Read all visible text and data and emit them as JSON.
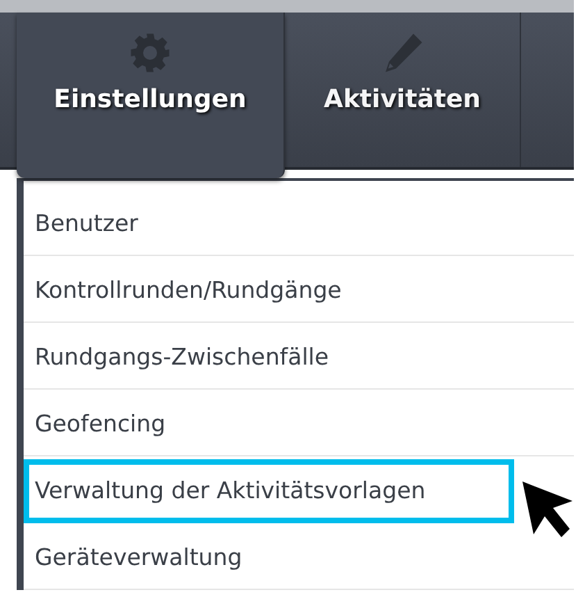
{
  "nav_tabs": [
    {
      "label": "Einstellungen",
      "kind": "gear",
      "selected": true
    },
    {
      "label": "Aktivitäten",
      "kind": "pencil",
      "selected": false
    }
  ],
  "menu_items": [
    {
      "label": "Benutzer",
      "selected": false
    },
    {
      "label": "Kontrollrunden/Rundgänge",
      "selected": false
    },
    {
      "label": "Rundgangs-Zwischenfälle",
      "selected": false
    },
    {
      "label": "Geofencing",
      "selected": false
    },
    {
      "label": "Verwaltung der Aktivitätsvorlagen",
      "selected": true
    },
    {
      "label": "Geräteverwaltung",
      "selected": false
    }
  ]
}
